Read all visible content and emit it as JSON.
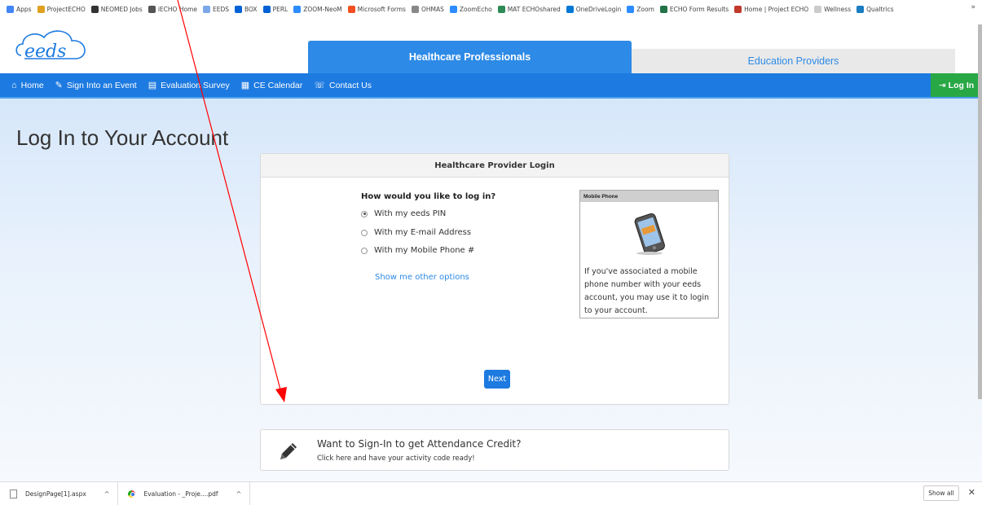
{
  "bookmarks": [
    {
      "label": "Apps",
      "color": "#4285f4"
    },
    {
      "label": "ProjectECHO",
      "color": "#e0a020"
    },
    {
      "label": "NEOMED Jobs",
      "color": "#333333"
    },
    {
      "label": "iECHO Home",
      "color": "#555555"
    },
    {
      "label": "EEDS",
      "color": "#7aa7e8"
    },
    {
      "label": "BOX",
      "color": "#0061d5"
    },
    {
      "label": "PERL",
      "color": "#0061d5"
    },
    {
      "label": "ZOOM-NeoM",
      "color": "#2d8cff"
    },
    {
      "label": "Microsoft Forms",
      "color": "#f25022"
    },
    {
      "label": "OHMAS",
      "color": "#888888"
    },
    {
      "label": "ZoomEcho",
      "color": "#2d8cff"
    },
    {
      "label": "MAT ECHOshared",
      "color": "#2e8b57"
    },
    {
      "label": "OneDriveLogin",
      "color": "#0078d4"
    },
    {
      "label": "Zoom",
      "color": "#2d8cff"
    },
    {
      "label": "ECHO Form Results",
      "color": "#217346"
    },
    {
      "label": "Home | Project ECHO",
      "color": "#c0392b"
    },
    {
      "label": "Wellness",
      "color": "#cccccc"
    },
    {
      "label": "Qualtrics",
      "color": "#1a7cc1"
    }
  ],
  "bookmarks_more": "»",
  "logo_text": "eeds",
  "tabs": {
    "active": "Healthcare Professionals",
    "inactive": "Education Providers"
  },
  "nav": {
    "items": [
      {
        "label": "Home",
        "icon": "⌂"
      },
      {
        "label": "Sign Into an Event",
        "icon": "✎"
      },
      {
        "label": "Evaluation Survey",
        "icon": "▤"
      },
      {
        "label": "CE Calendar",
        "icon": "▦"
      },
      {
        "label": "Contact Us",
        "icon": "☏"
      }
    ],
    "login": "Log In",
    "login_icon": "⇥"
  },
  "page_title": "Log In to Your Account",
  "login_card": {
    "header": "Healthcare Provider Login",
    "question": "How would you like to log in?",
    "options": [
      {
        "label": "With my eeds PIN",
        "selected": true
      },
      {
        "label": "With my E-mail Address",
        "selected": false
      },
      {
        "label": "With my Mobile Phone #",
        "selected": false
      }
    ],
    "other_link": "Show me other options",
    "mobile_box": {
      "title": "Mobile Phone",
      "text": "If you've associated a mobile phone number with your eeds account, you may use it to login to your account."
    },
    "next": "Next"
  },
  "attendance": {
    "title": "Want to Sign-In to get Attendance Credit?",
    "subtitle": "Click here and have your activity code ready!"
  },
  "downloads": {
    "items": [
      {
        "name": "DesignPage[1].aspx",
        "icon": "file-icon"
      },
      {
        "name": "Evaluation - _Proje....pdf",
        "icon": "chrome-icon"
      }
    ],
    "show_all": "Show all",
    "close": "✕"
  },
  "colors": {
    "primary": "#1d7ae0",
    "tab_active": "#2d8ae6",
    "login_green": "#28a745",
    "annotation": "#ff0000"
  }
}
